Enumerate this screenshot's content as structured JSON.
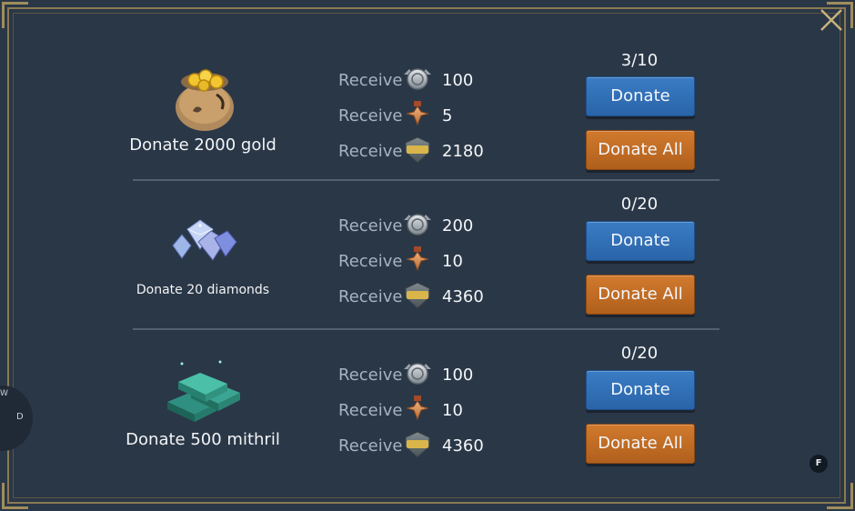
{
  "close_icon": "close-x-icon",
  "side_label_d": "D",
  "side_label_w": "W",
  "f_badge": "F",
  "colors": {
    "background": "#2a3747",
    "gold_frame": "#8a7a52",
    "blue_button": "#2a64a8",
    "orange_button": "#b05f1c"
  },
  "rows": [
    {
      "item_icon": "gold-bag-icon",
      "label": "Donate 2000 gold",
      "counter": "3/10",
      "rewards": [
        {
          "label": "Receive",
          "icon": "silver-medal-icon",
          "amount": "100"
        },
        {
          "label": "Receive",
          "icon": "bronze-cross-medal-icon",
          "amount": "5"
        },
        {
          "label": "Receive",
          "icon": "exp-badge-icon",
          "amount": "2180"
        }
      ],
      "donate_label": "Donate",
      "donate_all_label": "Donate All"
    },
    {
      "item_icon": "diamonds-icon",
      "label": "Donate 20 diamonds",
      "counter": "0/20",
      "rewards": [
        {
          "label": "Receive",
          "icon": "silver-medal-icon",
          "amount": "200"
        },
        {
          "label": "Receive",
          "icon": "bronze-cross-medal-icon",
          "amount": "10"
        },
        {
          "label": "Receive",
          "icon": "exp-badge-icon",
          "amount": "4360"
        }
      ],
      "donate_label": "Donate",
      "donate_all_label": "Donate All"
    },
    {
      "item_icon": "mithril-bars-icon",
      "label": "Donate 500 mithril",
      "counter": "0/20",
      "rewards": [
        {
          "label": "Receive",
          "icon": "silver-medal-icon",
          "amount": "100"
        },
        {
          "label": "Receive",
          "icon": "bronze-cross-medal-icon",
          "amount": "10"
        },
        {
          "label": "Receive",
          "icon": "exp-badge-icon",
          "amount": "4360"
        }
      ],
      "donate_label": "Donate",
      "donate_all_label": "Donate All"
    }
  ]
}
